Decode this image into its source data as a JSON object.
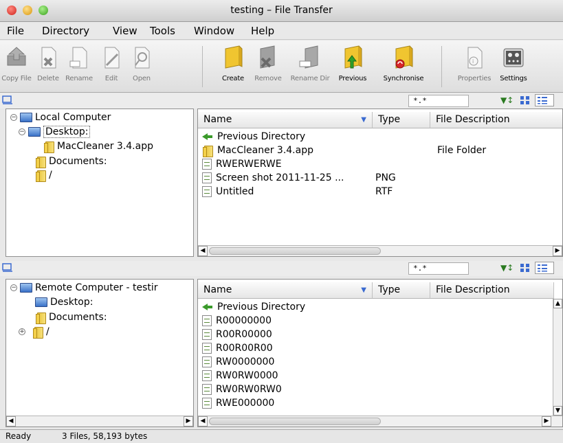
{
  "window": {
    "title": "testing – File Transfer"
  },
  "menu": [
    "File",
    "Directory",
    "View",
    "Tools",
    "Window",
    "Help"
  ],
  "toolbar": {
    "copy_file": "Copy File",
    "delete": "Delete",
    "rename": "Rename",
    "edit": "Edit",
    "open": "Open",
    "create": "Create",
    "remove": "Remove",
    "rename_dir": "Rename Dir",
    "previous": "Previous",
    "synchronise": "Synchronise",
    "properties": "Properties",
    "settings": "Settings"
  },
  "local": {
    "filter": "*.*",
    "tree": {
      "root": "Local Computer",
      "desktop": "Desktop:",
      "desktop_child": "MacCleaner 3.4.app",
      "documents": "Documents:",
      "slash": "/"
    },
    "columns": {
      "name": "Name",
      "type": "Type",
      "desc": "File Description"
    },
    "rows": [
      {
        "name": "Previous Directory",
        "type": "",
        "desc": ""
      },
      {
        "name": "MacCleaner 3.4.app",
        "type": "",
        "desc": "File Folder"
      },
      {
        "name": "RWERWERWE",
        "type": "",
        "desc": ""
      },
      {
        "name": "Screen shot 2011-11-25 ...",
        "type": "PNG",
        "desc": ""
      },
      {
        "name": "Untitled",
        "type": "RTF",
        "desc": ""
      }
    ]
  },
  "remote": {
    "filter": "*.*",
    "tree": {
      "root": "Remote Computer - testir",
      "desktop": "Desktop:",
      "documents": "Documents:",
      "slash": "/"
    },
    "columns": {
      "name": "Name",
      "type": "Type",
      "desc": "File Description"
    },
    "rows": [
      {
        "name": "Previous Directory"
      },
      {
        "name": "R00000000"
      },
      {
        "name": "R00R00000"
      },
      {
        "name": "R00R00R00"
      },
      {
        "name": "RW0000000"
      },
      {
        "name": "RW0RW0000"
      },
      {
        "name": "RW0RW0RW0"
      },
      {
        "name": "RWE000000"
      }
    ]
  },
  "status": {
    "state": "Ready",
    "summary": "3 Files, 58,193 bytes"
  }
}
